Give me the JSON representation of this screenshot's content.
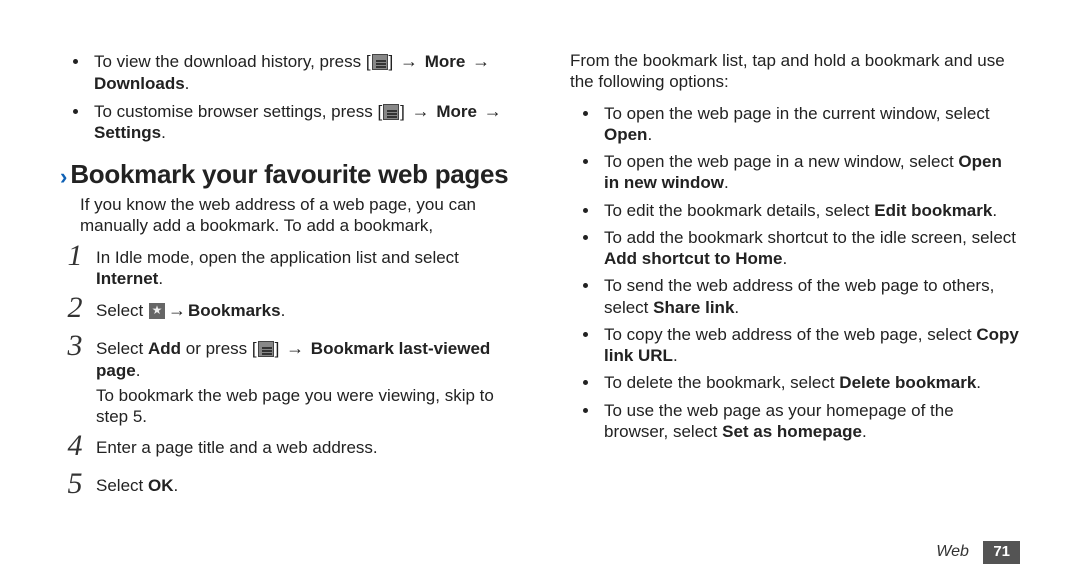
{
  "leftColumn": {
    "topBullets": [
      {
        "pre": "To view the download history, press [",
        "icon": "menu",
        "mid": "] ",
        "arrow": "→",
        "b1": " More ",
        "arrow2": "→",
        "b2": " Downloads",
        "suffix": "."
      },
      {
        "pre": "To customise browser settings, press [",
        "icon": "menu",
        "mid": "] ",
        "arrow": "→",
        "b1": " More ",
        "arrow2": "→",
        "b2": " Settings",
        "suffix": "."
      }
    ],
    "heading": "Bookmark your favourite web pages",
    "intro": "If you know the web address of a web page, you can manually add a bookmark. To add a bookmark,",
    "steps": [
      {
        "num": "1",
        "lines": [
          {
            "text": "In Idle mode, open the application list and select "
          },
          {
            "bold": "Internet",
            "text2": "."
          }
        ]
      },
      {
        "num": "2",
        "select": "Select ",
        "icon": "star",
        "arrow": " → ",
        "bold": "Bookmarks",
        "suffix": "."
      },
      {
        "num": "3",
        "pre": "Select ",
        "bold1": "Add",
        "mid": " or press [",
        "icon": "menu",
        "mid2": "] ",
        "arrow": "→",
        "bold2": " Bookmark last-viewed page",
        "suffix": ".",
        "extra": "To bookmark the web page you were viewing, skip to step 5."
      },
      {
        "num": "4",
        "text": "Enter a page title and a web address."
      },
      {
        "num": "5",
        "pre": "Select ",
        "bold": "OK",
        "suffix": "."
      }
    ]
  },
  "rightColumn": {
    "intro": "From the bookmark list, tap and hold a bookmark and use the following options:",
    "bullets": [
      {
        "text": "To open the web page in the current window, select ",
        "bold": "Open",
        "suffix": "."
      },
      {
        "text": "To open the web page in a new window, select ",
        "bold": "Open in new window",
        "suffix": "."
      },
      {
        "text": "To edit the bookmark details, select ",
        "bold": "Edit bookmark",
        "suffix": "."
      },
      {
        "text": "To add the bookmark shortcut to the idle screen, select ",
        "bold": "Add shortcut to Home",
        "suffix": "."
      },
      {
        "text": "To send the web address of the web page to others, select ",
        "bold": "Share link",
        "suffix": "."
      },
      {
        "text": "To copy the web address of the web page, select ",
        "bold": "Copy link URL",
        "suffix": "."
      },
      {
        "text": "To delete the bookmark, select ",
        "bold": "Delete bookmark",
        "suffix": "."
      },
      {
        "text": "To use the web page as your homepage of the browser, select ",
        "bold": "Set as homepage",
        "suffix": "."
      }
    ]
  },
  "footer": {
    "section": "Web",
    "pageNumber": "71"
  }
}
